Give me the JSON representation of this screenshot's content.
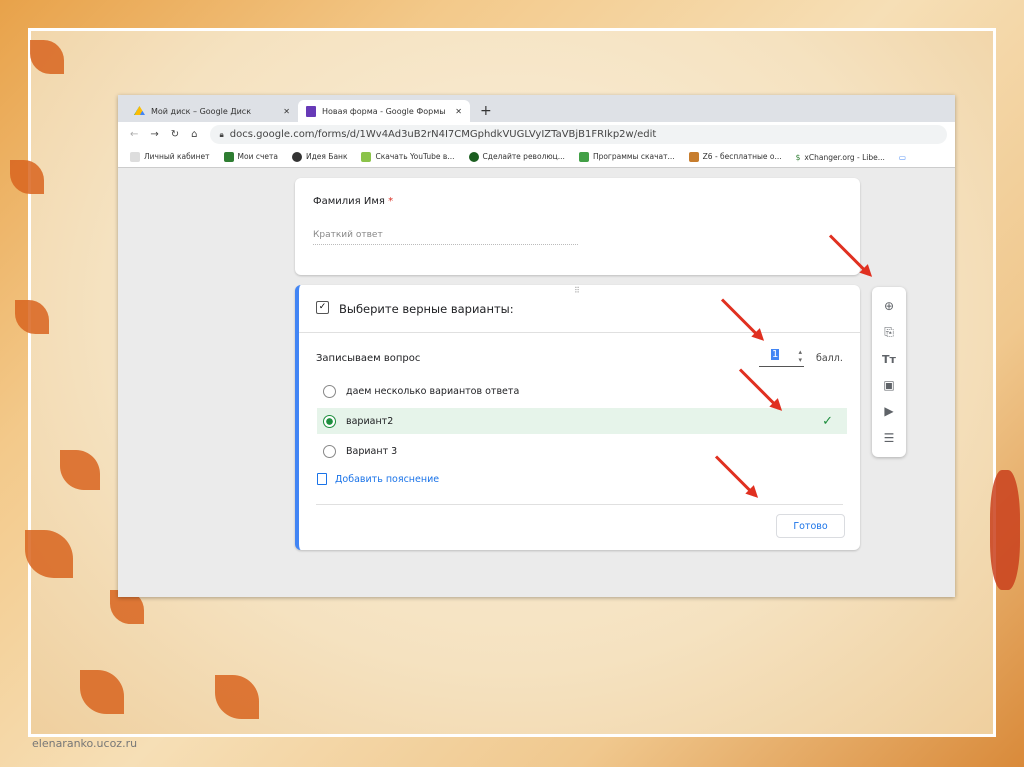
{
  "browser": {
    "tabs": [
      {
        "title": "Мой диск – Google Диск",
        "icon": "google-drive-icon"
      },
      {
        "title": "Новая форма - Google Формы",
        "icon": "google-forms-icon"
      }
    ],
    "new_tab": "+",
    "url": "docs.google.com/forms/d/1Wv4Ad3uB2rN4I7CMGphdkVUGLVyIZTaVBjB1FRIkp2w/edit",
    "bookmarks": [
      "Личный кабинет",
      "Мои счета",
      "Идея Банк",
      "Скачать YouTube в...",
      "Сделайте революц...",
      "Программы скачат...",
      "Z6 - бесплатные о...",
      "xChanger.org - Libe..."
    ]
  },
  "form": {
    "q1": {
      "title": "Фамилия Имя",
      "required": "*",
      "placeholder": "Краткий ответ"
    },
    "q2": {
      "header": "Выберите верные варианты:",
      "question": "Записываем вопрос",
      "points": "1",
      "points_label": "балл.",
      "options": [
        {
          "label": "даем несколько вариантов ответа",
          "selected": false
        },
        {
          "label": "вариант2",
          "selected": true
        },
        {
          "label": "Вариант 3",
          "selected": false
        }
      ],
      "add_feedback": "Добавить пояснение",
      "done": "Готово"
    }
  },
  "sidebar": [
    "add-question-icon",
    "import-questions-icon",
    "add-title-icon",
    "add-image-icon",
    "add-video-icon",
    "add-section-icon"
  ],
  "watermark": "elenaranko.ucoz.ru",
  "colors": {
    "accent": "#4285f4",
    "correct": "#1e8e3e",
    "arrows": "#e03020"
  }
}
